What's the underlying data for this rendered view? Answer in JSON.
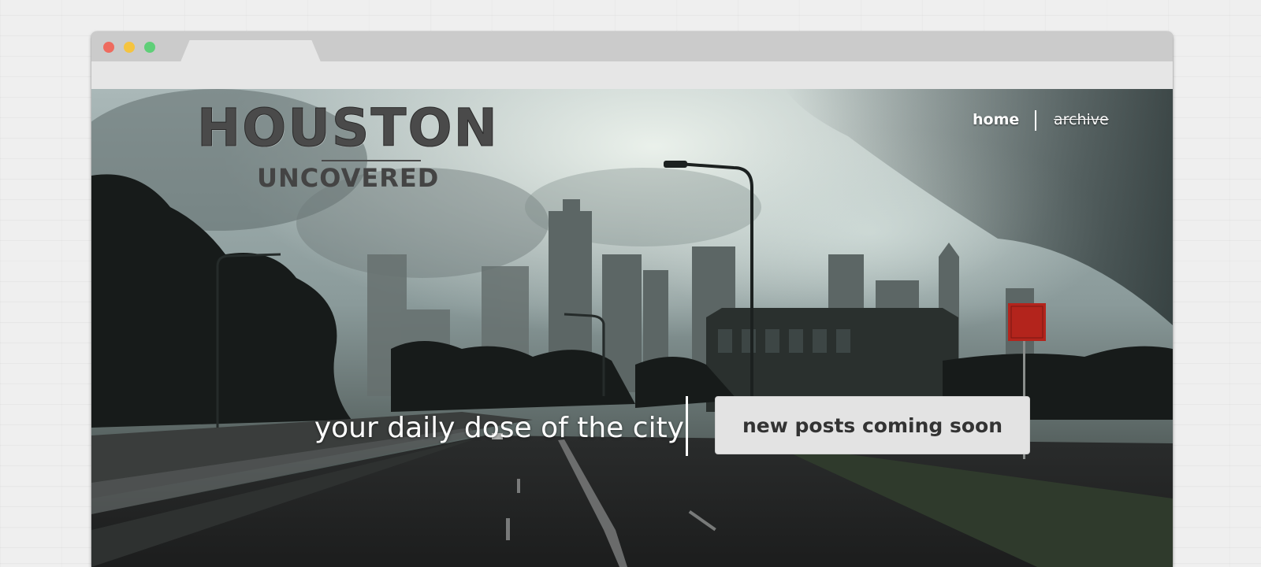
{
  "site": {
    "logo_title": "HOUSTON",
    "logo_subtitle": "UNCOVERED"
  },
  "nav": {
    "home": "home",
    "archive": "archive"
  },
  "hero": {
    "tagline": "your daily dose of the city",
    "cta": "new posts coming soon"
  },
  "colors": {
    "window_close": "#ee6b5f",
    "window_minimize": "#f5c440",
    "window_maximize": "#5fcf78",
    "cta_background": "#e3e3e3",
    "logo_text": "#4a4a4a"
  }
}
